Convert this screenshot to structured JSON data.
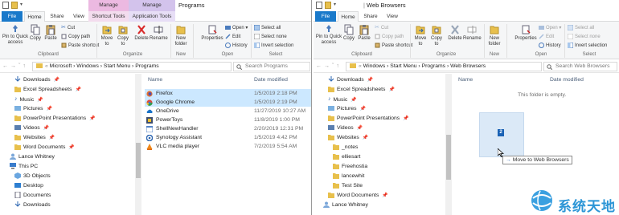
{
  "left": {
    "title": "Programs",
    "ctx_tabs": [
      "Manage",
      "Manage"
    ],
    "tabs": [
      "File",
      "Home",
      "Share",
      "View",
      "Shortcut Tools",
      "Application Tools"
    ],
    "ribbon": {
      "pin": "Pin to Quick access",
      "copy": "Copy",
      "paste": "Paste",
      "cut": "Cut",
      "copy_path": "Copy path",
      "paste_shortcut": "Paste shortcut",
      "move_to": "Move to",
      "copy_to": "Copy to",
      "delete": "Delete",
      "rename": "Rename",
      "new_folder": "New folder",
      "properties": "Properties",
      "open": "Open",
      "edit": "Edit",
      "history": "History",
      "select_all": "Select all",
      "select_none": "Select none",
      "invert_selection": "Invert selection",
      "groups": [
        "Clipboard",
        "Organize",
        "New",
        "Open",
        "Select"
      ]
    },
    "path": [
      "Microsoft",
      "Windows",
      "Start Menu",
      "Programs"
    ],
    "search_placeholder": "Search Programs",
    "nav": [
      "Downloads",
      "Excel Spreadsheets",
      "Music",
      "Pictures",
      "PowerPoint Presentations",
      "Videos",
      "Websites",
      "Word Documents",
      "Lance Whitney",
      "This PC",
      "3D Objects",
      "Desktop",
      "Documents",
      "Downloads"
    ],
    "columns": {
      "name": "Name",
      "date": "Date modified"
    },
    "files": [
      {
        "name": "Firefox",
        "date": "1/5/2019 2:18 PM"
      },
      {
        "name": "Google Chrome",
        "date": "1/5/2019 2:19 PM"
      },
      {
        "name": "OneDrive",
        "date": "11/27/2019 10:27 AM"
      },
      {
        "name": "PowerToys",
        "date": "11/8/2019 1:00 PM"
      },
      {
        "name": "ShellNewHandler",
        "date": "2/20/2019 12:31 PM"
      },
      {
        "name": "Synology Assistant",
        "date": "1/5/2019 4:42 PM"
      },
      {
        "name": "VLC media player",
        "date": "7/2/2019 5:54 AM"
      }
    ]
  },
  "right": {
    "title": "Web Browsers",
    "tabs": [
      "File",
      "Home",
      "Share",
      "View"
    ],
    "ribbon": {
      "pin": "Pin to Quick access",
      "copy": "Copy",
      "paste": "Paste",
      "cut": "Cut",
      "copy_path": "Copy path",
      "paste_shortcut": "Paste shortcut",
      "move_to": "Move to",
      "copy_to": "Copy to",
      "delete": "Delete",
      "rename": "Rename",
      "new_folder": "New folder",
      "properties": "Properties",
      "open": "Open",
      "edit": "Edit",
      "history": "History",
      "select_all": "Select all",
      "select_none": "Select none",
      "invert_selection": "Invert selection",
      "groups": [
        "Clipboard",
        "Organize",
        "New",
        "Open",
        "Select"
      ]
    },
    "path": [
      "Windows",
      "Start Menu",
      "Programs",
      "Web Browsers"
    ],
    "search_placeholder": "Search Web Browsers",
    "nav": [
      "Downloads",
      "Excel Spreadsheets",
      "Music",
      "Pictures",
      "PowerPoint Presentations",
      "Videos",
      "Websites",
      "_notes",
      "elliesart",
      "Freehostia",
      "lancewhit",
      "Test Site",
      "Word Documents",
      "Lance Whitney"
    ],
    "columns": {
      "name": "Name",
      "date": "Date modified"
    },
    "empty_text": "This folder is empty.",
    "drag_count": "2",
    "drag_tooltip": "Move to Web Browsers"
  },
  "watermark": "系统天地",
  "colors": {
    "file_tab": "#1979ca",
    "selection": "#cce8ff",
    "folder": "#e8c04c"
  }
}
